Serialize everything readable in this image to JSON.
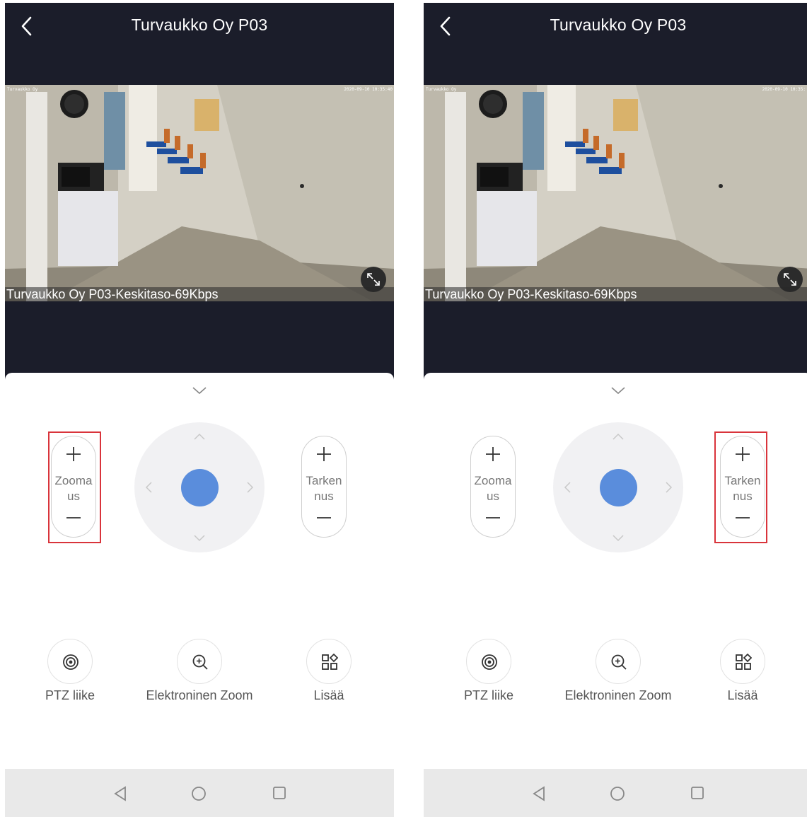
{
  "screens": [
    {
      "header": {
        "title": "Turvaukko Oy P03"
      },
      "video": {
        "osd_name": "Turvaukko Oy",
        "osd_timestamp": "2020-09-10 10:35:40",
        "stream_label": "Turvaukko Oy P03-Keskitaso-69Kbps"
      },
      "controls": {
        "zoom": {
          "label_line1": "Zooma",
          "label_line2": "us",
          "plus": "+",
          "minus": "—"
        },
        "focus": {
          "label_line1": "Tarken",
          "label_line2": "nus",
          "plus": "+",
          "minus": "—"
        },
        "highlighted": "zoom"
      },
      "actions": [
        {
          "label": "PTZ liike",
          "icon": "ptz-target-icon"
        },
        {
          "label": "Elektroninen Zoom",
          "icon": "zoom-in-icon"
        },
        {
          "label": "Lisää",
          "icon": "more-grid-icon"
        }
      ]
    },
    {
      "header": {
        "title": "Turvaukko Oy P03"
      },
      "video": {
        "osd_name": "Turvaukko Oy",
        "osd_timestamp": "2020-09-10 10:35:",
        "stream_label": "Turvaukko Oy P03-Keskitaso-69Kbps"
      },
      "controls": {
        "zoom": {
          "label_line1": "Zooma",
          "label_line2": "us",
          "plus": "+",
          "minus": "—"
        },
        "focus": {
          "label_line1": "Tarken",
          "label_line2": "nus",
          "plus": "+",
          "minus": "—"
        },
        "highlighted": "focus"
      },
      "actions": [
        {
          "label": "PTZ liike",
          "icon": "ptz-target-icon"
        },
        {
          "label": "Elektroninen Zoom",
          "icon": "zoom-in-icon"
        },
        {
          "label": "Lisää",
          "icon": "more-grid-icon"
        }
      ]
    }
  ],
  "colors": {
    "header_bg": "#1b1d2a",
    "dpad_center": "#5a8ddc",
    "highlight_border": "#d9343b",
    "navbar_bg": "#e9e9e9"
  }
}
